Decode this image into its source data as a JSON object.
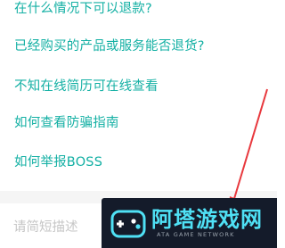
{
  "faq": {
    "items": [
      {
        "label": "在什么情况下可以退款?"
      },
      {
        "label": "已经购买的产品或服务能否退货?"
      },
      {
        "label": "不知在线简历可在线查看"
      },
      {
        "label": "如何查看防骗指南"
      },
      {
        "label": "如何举报BOSS"
      }
    ]
  },
  "input": {
    "placeholder": "请简短描述"
  },
  "watermark": {
    "title": "阿塔游戏网",
    "subtitle": "ATA GAME NETWORK"
  },
  "colors": {
    "link": "#14b0a4",
    "arrow": "#e8383d",
    "watermark_bg": "#141b2a",
    "watermark_title": "#4fe1f5"
  }
}
